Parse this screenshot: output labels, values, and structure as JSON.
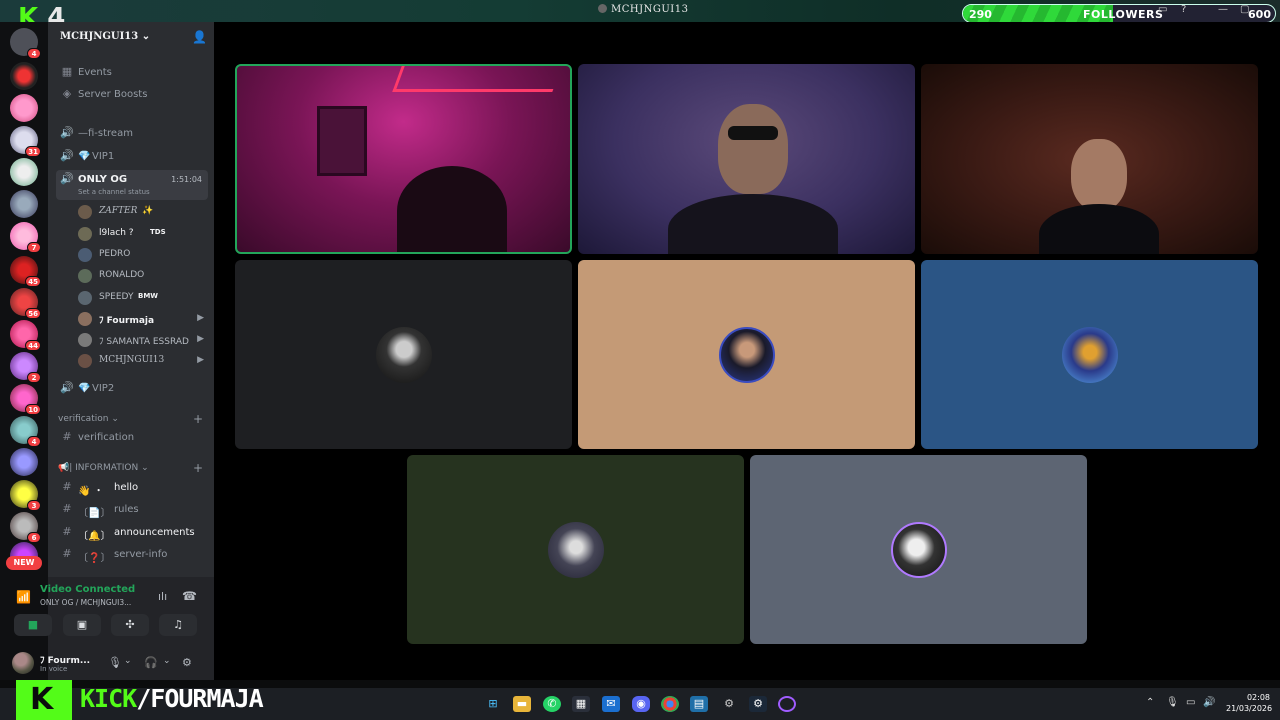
{
  "window": {
    "title": "MCHJNGUI13"
  },
  "overlay": {
    "k_label": "K",
    "k_number": "4",
    "followers_current": "290",
    "followers_label": "FOLLOWERS",
    "followers_goal": "600",
    "followers_progress": 0.48,
    "kick_k": "K",
    "kick_brand": "KICK",
    "kick_slash": "/",
    "kick_channel": "FOURMAJA",
    "accent_green": "#53fc18"
  },
  "server_list": {
    "badges": [
      "4",
      "31",
      "7",
      "45",
      "56",
      "44",
      "2",
      "10",
      "4",
      "3",
      "6"
    ],
    "new_label": "NEW"
  },
  "sidebar": {
    "server_name": "MCHJNGUI13",
    "top_items": [
      {
        "label": "Events",
        "icon": "calendar-icon"
      },
      {
        "label": "Server Boosts",
        "icon": "boost-icon"
      }
    ],
    "voice_channels": [
      {
        "label": "—fi-stream",
        "icon": "speaker-icon"
      },
      {
        "label": "VIP1",
        "icon": "speaker-icon"
      }
    ],
    "active_channel": {
      "label": "ONLY OG",
      "timer": "1:51:04",
      "status_prompt": "Set a channel status"
    },
    "members": [
      {
        "name": "ZAFTER",
        "suffix": "✨",
        "color": "#6b5b4b"
      },
      {
        "name": "l9lach ?",
        "suffix": "TDS",
        "color": "#6d6a55"
      },
      {
        "name": "PEDRO",
        "suffix": "",
        "color": "#4b5c73"
      },
      {
        "name": "RONALDO",
        "suffix": "",
        "color": "#5c6b5a"
      },
      {
        "name": "SPEEDY",
        "suffix": "BMW",
        "color": "#5a6670"
      },
      {
        "name": "ﾌ Fourmaja",
        "suffix": "",
        "color": "#8a6f5f",
        "camera": true
      },
      {
        "name": "ﾌ SAMANTA ESSRAD",
        "suffix": "",
        "color": "#7a7a7a",
        "camera": true
      },
      {
        "name": "MCHJNGUI13",
        "suffix": "",
        "color": "#6a5045",
        "camera": true
      }
    ],
    "vip2": "VIP2",
    "verification_category": "verification",
    "verification_channel": "verification",
    "information_category": "| INFORMATION",
    "text_channels": [
      {
        "label": "hello",
        "prefix": "👋 ・"
      },
      {
        "label": "rules",
        "prefix": "〔📄〕"
      },
      {
        "label": "announcements",
        "prefix": "〔🔔〕"
      },
      {
        "label": "server-info",
        "prefix": "〔❓〕"
      }
    ]
  },
  "voice_panel": {
    "status": "Video Connected",
    "channel_path": "ONLY OG / MCHJNGUI3..."
  },
  "user_panel": {
    "name": "ﾌ Fourm...",
    "status": "In voice"
  },
  "taskbar": {
    "time": "02:08",
    "date": "21/03/2026"
  }
}
